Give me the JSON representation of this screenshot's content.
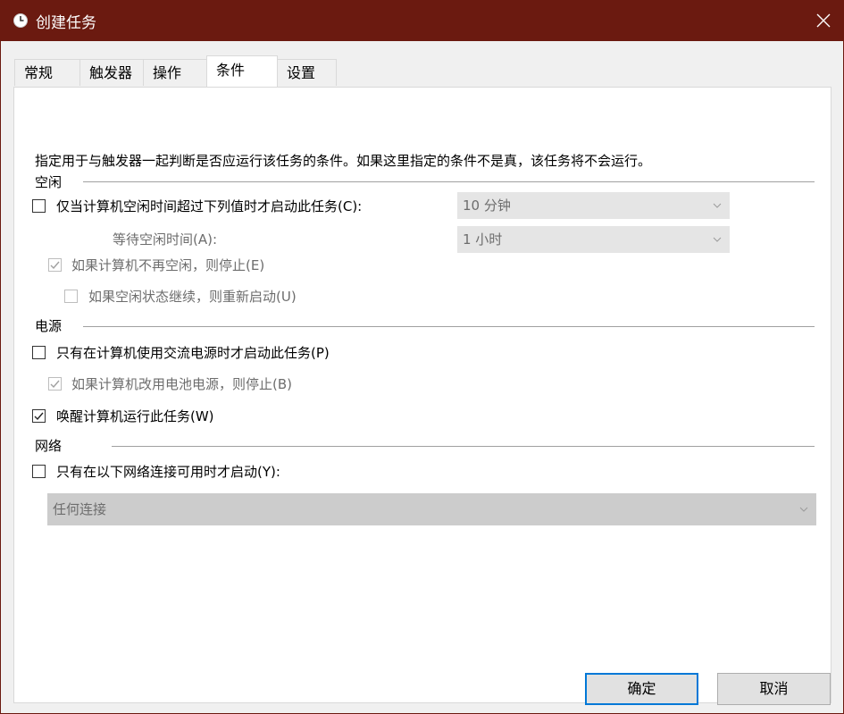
{
  "window": {
    "title": "创建任务"
  },
  "tabs": [
    {
      "label": "常规"
    },
    {
      "label": "触发器"
    },
    {
      "label": "操作"
    },
    {
      "label": "条件"
    },
    {
      "label": "设置"
    }
  ],
  "description": "指定用于与触发器一起判断是否应运行该任务的条件。如果这里指定的条件不是真，该任务将不会运行。",
  "idle": {
    "group_label": "空闲",
    "start_if_idle": {
      "label": "仅当计算机空闲时间超过下列值时才启动此任务(C):",
      "checked": false
    },
    "idle_duration": {
      "value": "10 分钟"
    },
    "wait_label": "等待空闲时间(A):",
    "wait_duration": {
      "value": "1 小时"
    },
    "stop_if_not_idle": {
      "label": "如果计算机不再空闲，则停止(E)",
      "checked": true
    },
    "restart_if_idle": {
      "label": "如果空闲状态继续，则重新启动(U)",
      "checked": false
    }
  },
  "power": {
    "group_label": "电源",
    "ac_only": {
      "label": "只有在计算机使用交流电源时才启动此任务(P)",
      "checked": false
    },
    "stop_on_battery": {
      "label": "如果计算机改用电池电源，则停止(B)",
      "checked": true
    },
    "wake": {
      "label": "唤醒计算机运行此任务(W)",
      "checked": true
    }
  },
  "network": {
    "group_label": "网络",
    "only_if_network": {
      "label": "只有在以下网络连接可用时才启动(Y):",
      "checked": false
    },
    "connection": {
      "value": "任何连接"
    }
  },
  "buttons": {
    "ok": "确定",
    "cancel": "取消"
  },
  "colors": {
    "titlebar": "#6b1a10",
    "accent": "#0078d7",
    "disabled": "#6d6d6d"
  }
}
